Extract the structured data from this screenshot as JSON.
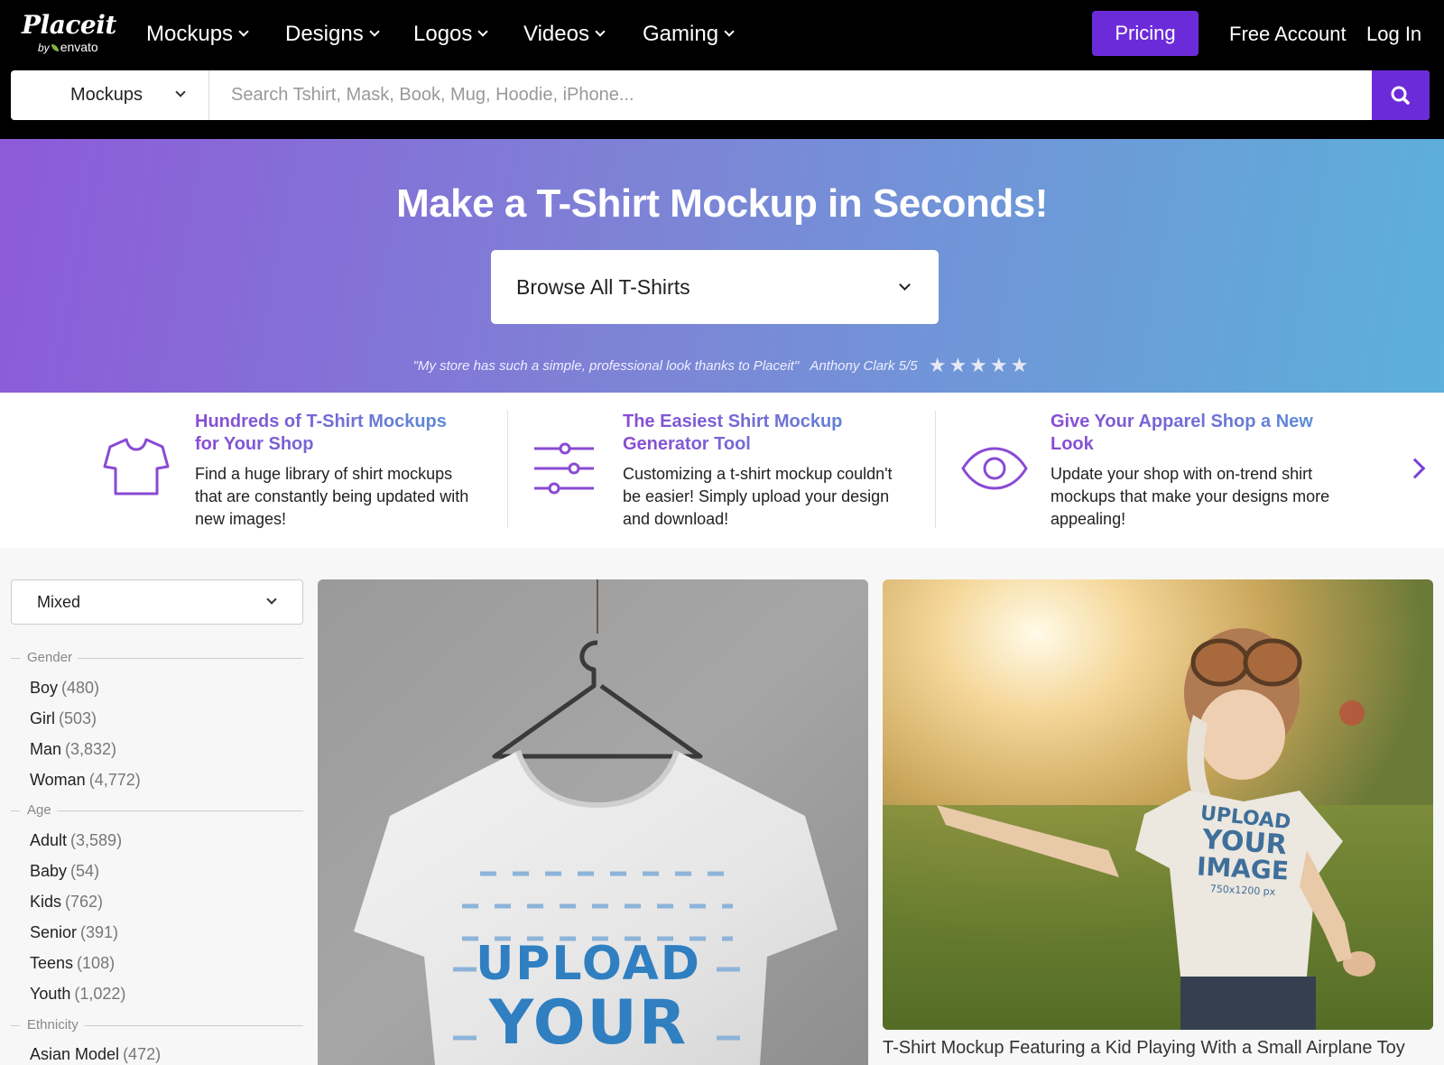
{
  "brand": {
    "name": "Placeit",
    "by": "by",
    "company": "envato"
  },
  "nav": {
    "items": [
      {
        "label": "Mockups"
      },
      {
        "label": "Designs"
      },
      {
        "label": "Logos"
      },
      {
        "label": "Videos"
      },
      {
        "label": "Gaming"
      }
    ],
    "pricing": "Pricing",
    "free_account": "Free Account",
    "login": "Log In"
  },
  "search": {
    "category": "Mockups",
    "placeholder": "Search Tshirt, Mask, Book, Mug, Hoodie, iPhone...",
    "icon": "search-icon"
  },
  "hero": {
    "title": "Make a T-Shirt Mockup in Seconds!",
    "browse_label": "Browse All T-Shirts",
    "testimonial": "\"My store has such a simple, professional look thanks to Placeit\"",
    "author": "Anthony Clark 5/5",
    "stars": "★★★★★",
    "rating": 5
  },
  "features": [
    {
      "icon": "tshirt-icon",
      "title": "Hundreds of T-Shirt Mockups for Your Shop",
      "desc": "Find a huge library of shirt mockups that are constantly being updated with new images!"
    },
    {
      "icon": "sliders-icon",
      "title": "The Easiest Shirt Mockup Generator Tool",
      "desc": "Customizing a t-shirt mockup couldn't be easier! Simply upload your design and download!"
    },
    {
      "icon": "eye-icon",
      "title": "Give Your Apparel Shop a New Look",
      "desc": "Update your shop with on-trend shirt mockups that make your designs more appealing!"
    }
  ],
  "sidebar": {
    "sort": "Mixed",
    "groups": [
      {
        "title": "Gender",
        "items": [
          {
            "label": "Boy",
            "count": "(480)"
          },
          {
            "label": "Girl",
            "count": "(503)"
          },
          {
            "label": "Man",
            "count": "(3,832)"
          },
          {
            "label": "Woman",
            "count": "(4,772)"
          }
        ]
      },
      {
        "title": "Age",
        "items": [
          {
            "label": "Adult",
            "count": "(3,589)"
          },
          {
            "label": "Baby",
            "count": "(54)"
          },
          {
            "label": "Kids",
            "count": "(762)"
          },
          {
            "label": "Senior",
            "count": "(391)"
          },
          {
            "label": "Teens",
            "count": "(108)"
          },
          {
            "label": "Youth",
            "count": "(1,022)"
          }
        ]
      },
      {
        "title": "Ethnicity",
        "items": [
          {
            "label": "Asian Model",
            "count": "(472)"
          }
        ]
      }
    ]
  },
  "cards": [
    {
      "print_line1": "UPLOAD",
      "print_line2": "YOUR",
      "caption": ""
    },
    {
      "print_line1": "UPLOAD",
      "print_line2": "YOUR",
      "print_line3": "IMAGE",
      "print_size": "750x1200 px",
      "caption": "T-Shirt Mockup Featuring a Kid Playing With a Small Airplane Toy"
    }
  ],
  "colors": {
    "accent": "#6c2bd9",
    "hero_start": "#8d5ad8",
    "hero_end": "#5cb0da",
    "topbar": "#000000"
  }
}
